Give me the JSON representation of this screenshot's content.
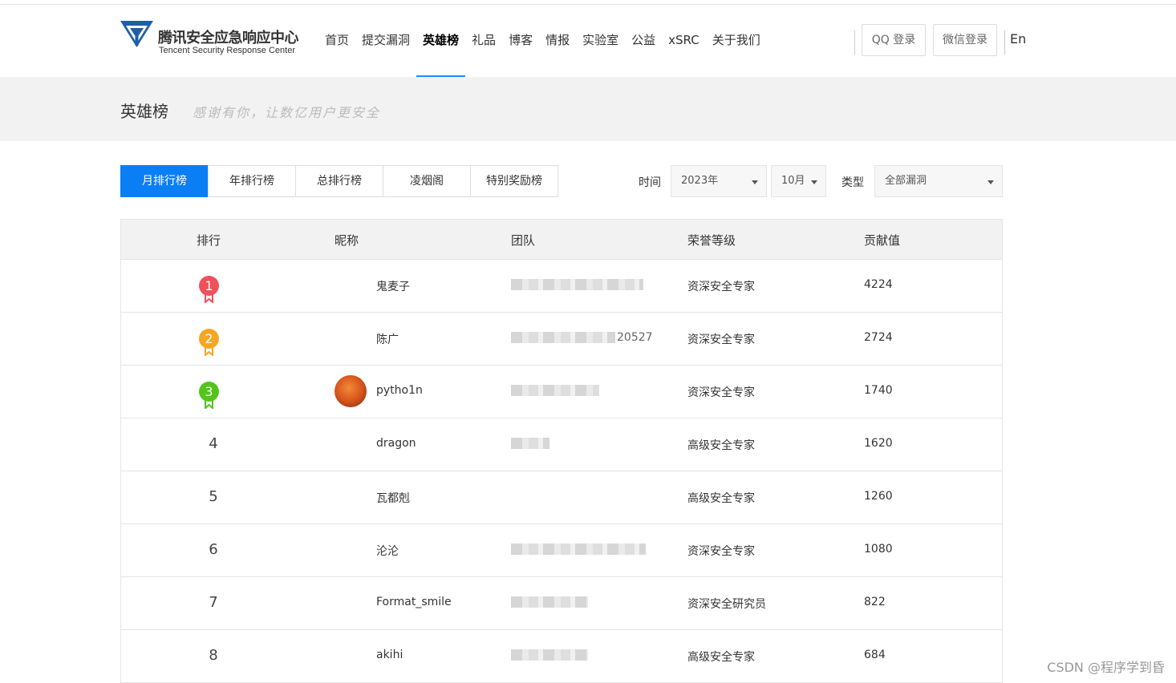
{
  "header": {
    "logo_cn": "腾讯安全应急响应中心",
    "logo_en": "Tencent Security Response Center",
    "nav": [
      {
        "label": "首页"
      },
      {
        "label": "提交漏洞"
      },
      {
        "label": "英雄榜",
        "active": true
      },
      {
        "label": "礼品"
      },
      {
        "label": "博客"
      },
      {
        "label": "情报"
      },
      {
        "label": "实验室"
      },
      {
        "label": "公益"
      },
      {
        "label": "xSRC"
      },
      {
        "label": "关于我们"
      }
    ],
    "qq_login": "QQ 登录",
    "wechat_login": "微信登录",
    "lang": "En"
  },
  "banner": {
    "title": "英雄榜",
    "subtitle": "感谢有你，让数亿用户更安全"
  },
  "tabs": [
    "月排行榜",
    "年排行榜",
    "总排行榜",
    "凌烟阁",
    "特别奖励榜"
  ],
  "filters": {
    "time_label": "时间",
    "year": "2023年",
    "month": "10月",
    "type_label": "类型",
    "type": "全部漏洞"
  },
  "table": {
    "headers": [
      "排行",
      "昵称",
      "团队",
      "荣誉等级",
      "贡献值"
    ],
    "rows": [
      {
        "rank": "1",
        "nickname": "鬼麦子",
        "team_visible": "",
        "level": "资深安全专家",
        "score": "4224"
      },
      {
        "rank": "2",
        "nickname": "陈广",
        "team_visible": "20527",
        "level": "资深安全专家",
        "score": "2724"
      },
      {
        "rank": "3",
        "nickname": "pytho1n",
        "team_visible": "",
        "level": "资深安全专家",
        "score": "1740"
      },
      {
        "rank": "4",
        "nickname": "dragon",
        "team_visible": "",
        "level": "高级安全专家",
        "score": "1620"
      },
      {
        "rank": "5",
        "nickname": "瓦都剋",
        "team_visible": "",
        "level": "高级安全专家",
        "score": "1260"
      },
      {
        "rank": "6",
        "nickname": "沦沦",
        "team_visible": "",
        "level": "资深安全专家",
        "score": "1080"
      },
      {
        "rank": "7",
        "nickname": "Format_smile",
        "team_visible": "",
        "level": "资深安全研究员",
        "score": "822"
      },
      {
        "rank": "8",
        "nickname": "akihi",
        "team_visible": "",
        "level": "高级安全专家",
        "score": "684"
      }
    ]
  },
  "colors": {
    "accent": "#0a7ef5",
    "medal_gold": "#f0515a",
    "medal_silver": "#f5a623",
    "medal_bronze": "#52c41a"
  },
  "watermark": "CSDN @程序学到昏"
}
